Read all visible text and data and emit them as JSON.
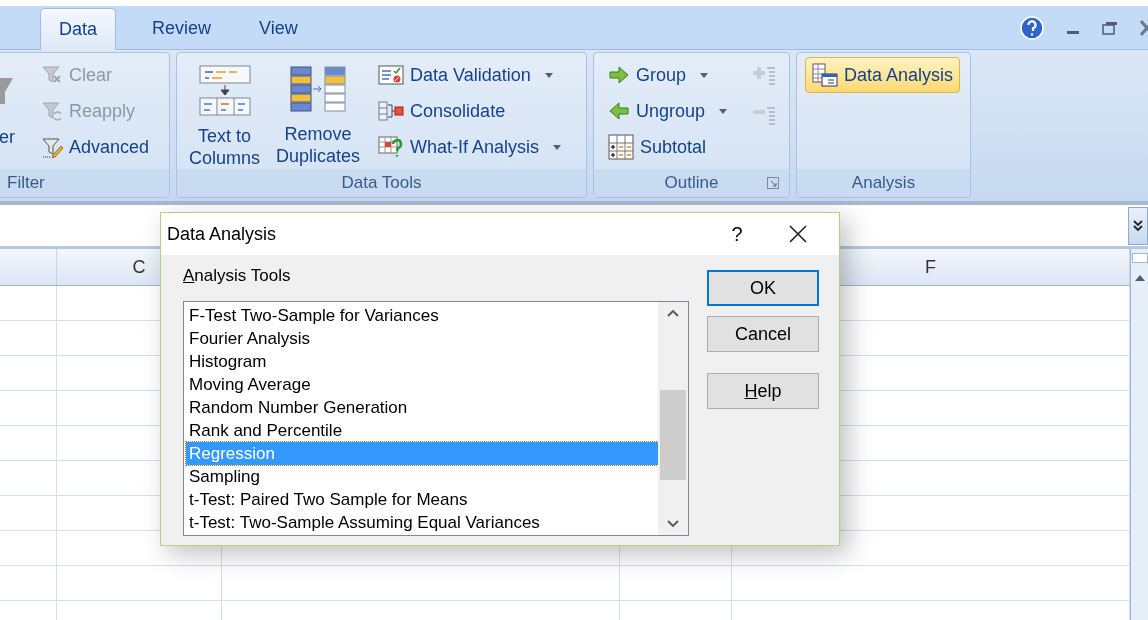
{
  "tabs": [
    {
      "label": "Data",
      "selected": true
    },
    {
      "label": "Review",
      "selected": false
    },
    {
      "label": "View",
      "selected": false
    }
  ],
  "ribbon_groups": [
    {
      "label": "Filter",
      "items": [
        {
          "kind": "large",
          "lines": [
            "er"
          ]
        },
        {
          "kind": "small",
          "label": "Clear",
          "disabled": true,
          "dropdown": false,
          "highlighted": false
        },
        {
          "kind": "small",
          "label": "Reapply",
          "disabled": true,
          "dropdown": false,
          "highlighted": false
        },
        {
          "kind": "small",
          "label": "Advanced",
          "disabled": false,
          "dropdown": false,
          "highlighted": false
        }
      ]
    },
    {
      "label": "Data Tools",
      "items": [
        {
          "kind": "large",
          "lines": [
            "Text to",
            "Columns"
          ]
        },
        {
          "kind": "large",
          "lines": [
            "Remove",
            "Duplicates"
          ]
        },
        {
          "kind": "small",
          "label": "Data Validation",
          "disabled": false,
          "dropdown": true,
          "highlighted": false
        },
        {
          "kind": "small",
          "label": "Consolidate",
          "disabled": false,
          "dropdown": false,
          "highlighted": false
        },
        {
          "kind": "small",
          "label": "What-If Analysis",
          "disabled": false,
          "dropdown": true,
          "highlighted": false
        }
      ]
    },
    {
      "label": "Outline",
      "launcher": true,
      "items": [
        {
          "kind": "small",
          "label": "Group",
          "disabled": false,
          "dropdown": true,
          "highlighted": false
        },
        {
          "kind": "small",
          "label": "Ungroup",
          "disabled": false,
          "dropdown": true,
          "highlighted": false
        },
        {
          "kind": "small",
          "label": "Subtotal",
          "disabled": false,
          "dropdown": false,
          "highlighted": false
        },
        {
          "kind": "side"
        }
      ]
    },
    {
      "label": "Analysis",
      "items": [
        {
          "kind": "small",
          "label": "Data Analysis",
          "disabled": false,
          "dropdown": false,
          "highlighted": true
        }
      ]
    }
  ],
  "sheet": {
    "column_headers": [
      "C",
      "F"
    ]
  },
  "dialog": {
    "title": "Data Analysis",
    "help": "?",
    "list_label": "Analysis Tools",
    "list_label_mnemonic": true,
    "items": [
      {
        "label": "F-Test Two-Sample for Variances",
        "selected": false
      },
      {
        "label": "Fourier Analysis",
        "selected": false
      },
      {
        "label": "Histogram",
        "selected": false
      },
      {
        "label": "Moving Average",
        "selected": false
      },
      {
        "label": "Random Number Generation",
        "selected": false
      },
      {
        "label": "Rank and Percentile",
        "selected": false
      },
      {
        "label": "Regression",
        "selected": true
      },
      {
        "label": "Sampling",
        "selected": false
      },
      {
        "label": "t-Test: Paired Two Sample for Means",
        "selected": false
      },
      {
        "label": "t-Test: Two-Sample Assuming Equal Variances",
        "selected": false
      }
    ],
    "buttons": [
      {
        "label": "OK",
        "default": true
      },
      {
        "label": "Cancel",
        "default": false
      },
      {
        "label": "Help",
        "default": false,
        "mnemonic": true
      }
    ]
  }
}
